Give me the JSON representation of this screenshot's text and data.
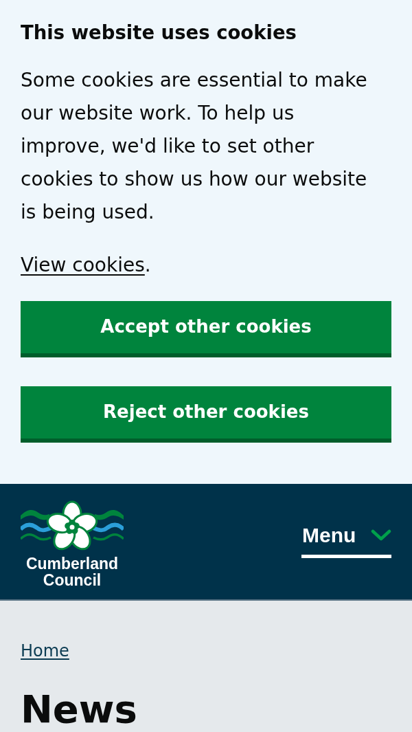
{
  "cookie_banner": {
    "title": "This website uses cookies",
    "message": "Some cookies are essential to make our website work. To help us improve, we'd like to set other cookies to show us how our website is being used.",
    "view_link": {
      "label": "View cookies",
      "suffix": "."
    },
    "buttons": [
      "Accept other cookies",
      "Reject other cookies"
    ]
  },
  "header": {
    "logo_text": "Cumberland Council",
    "menu": {
      "label": "Menu",
      "expanded": false
    }
  },
  "breadcrumbs": [
    "Home"
  ],
  "page_title": "News"
}
